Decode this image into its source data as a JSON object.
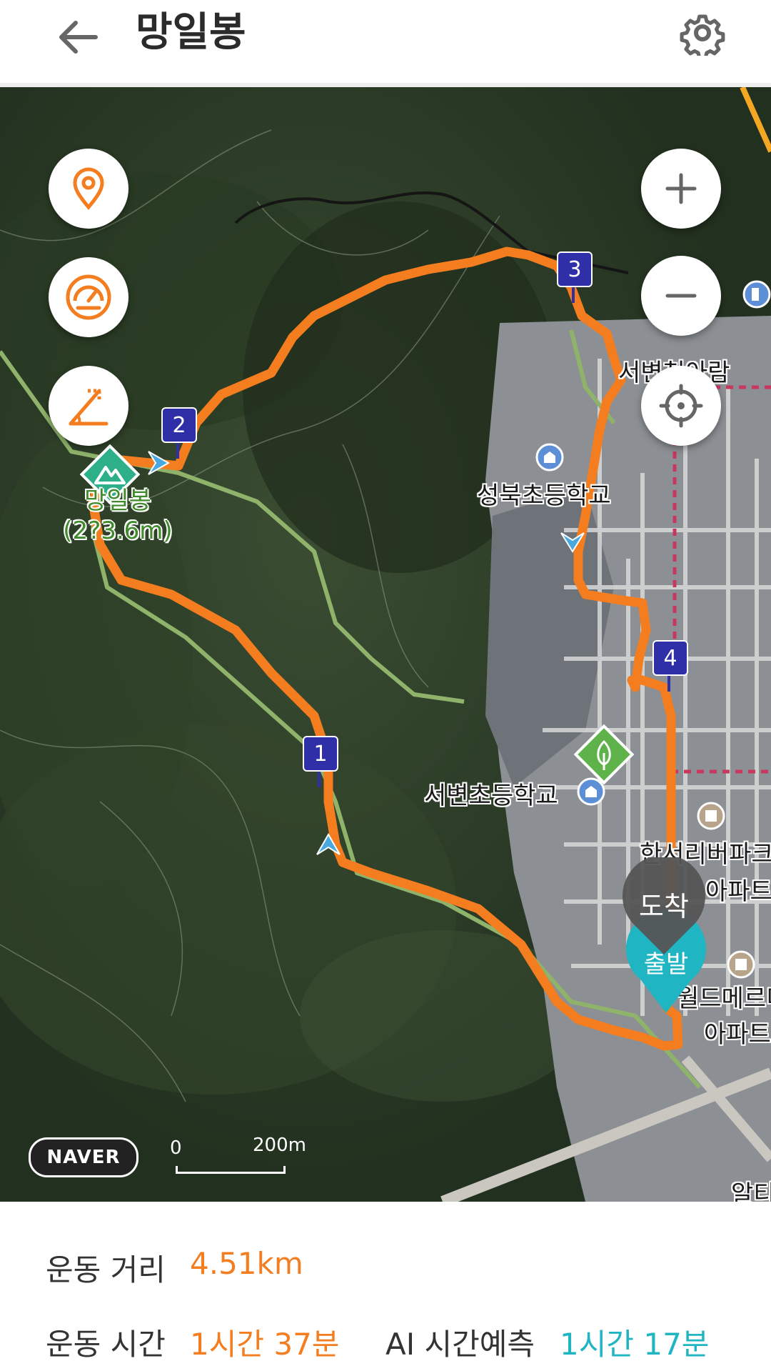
{
  "header": {
    "title": "망일봉",
    "back_icon": "arrow-left-icon",
    "settings_icon": "gear-icon"
  },
  "map": {
    "peak": {
      "name": "망일봉",
      "elevation": "(2?3.6m)"
    },
    "places": {
      "seobyeon_child": "서변천아람",
      "seongbuk_school": "성북초등학교",
      "seobyeon_school": "서변초등학교",
      "apartment_1_line1": "한서리버파크",
      "apartment_1_line2": "아파트",
      "apartment_2_line1": "월드메르디",
      "apartment_2_line2": "아파트",
      "bottom_right": "알티"
    },
    "markers": [
      "1",
      "2",
      "3",
      "4"
    ],
    "arrival_label": "도착",
    "start_label": "출발",
    "logo_text": "NAVER",
    "scale": {
      "zero": "0",
      "distance": "200m"
    },
    "colors": {
      "route": "#f47d1f",
      "trail": "#8fb36a",
      "marker": "#2f2fa8",
      "arrival": "#555555",
      "start": "#1fb5c2"
    }
  },
  "controls": {
    "left": [
      "location-pin-icon",
      "speedometer-icon",
      "elevation-icon"
    ],
    "right": [
      "zoom-in-icon",
      "zoom-out-icon",
      "crosshair-icon"
    ]
  },
  "stats": {
    "distance_label": "운동 거리",
    "distance_value": "4.51km",
    "time_label": "운동 시간",
    "time_value": "1시간 37분",
    "ai_label": "AI 시간예측",
    "ai_value": "1시간 17분",
    "colors": {
      "orange": "#f47d1f",
      "teal": "#1fb5c2"
    }
  }
}
